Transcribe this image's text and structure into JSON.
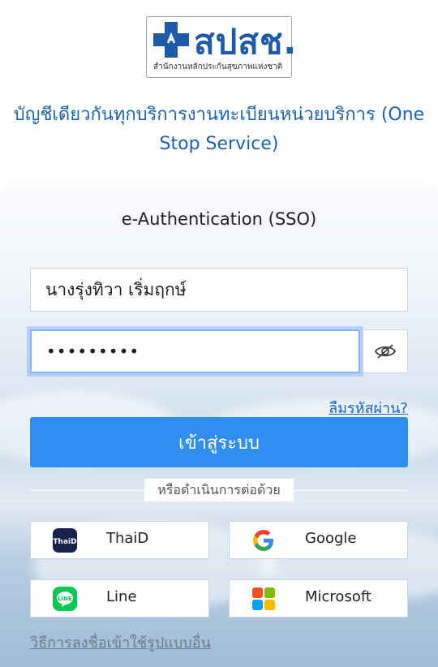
{
  "logo": {
    "text": "สปสช.",
    "subtitle": "สำนักงานหลักประกันสุขภาพแห่งชาติ"
  },
  "tagline": "บัญชีเดียวกันทุกบริการงานทะเบียนหน่วยบริการ (One Stop Service)",
  "login": {
    "title": "e-Authentication (SSO)",
    "username_value": "นางรุ่งทิวา เริ่มฤกษ์",
    "password_mask": "•••••••••",
    "forgot_label": "ลืมรหัสผ่าน?",
    "submit_label": "เข้าสู่ระบบ",
    "divider_text": "หรือดำเนินการต่อด้วย"
  },
  "providers": [
    {
      "label": "ThaiD",
      "icon": "thaid-icon"
    },
    {
      "label": "Google",
      "icon": "google-icon"
    },
    {
      "label": "Line",
      "icon": "line-icon"
    },
    {
      "label": "Microsoft",
      "icon": "microsoft-icon"
    }
  ],
  "other_signup_label": "วิธีการลงชื่อเข้าใช้รูปแบบอื่น",
  "colors": {
    "primary": "#2f8ff0",
    "brand": "#1f5aa8",
    "link": "#1a66c4"
  }
}
